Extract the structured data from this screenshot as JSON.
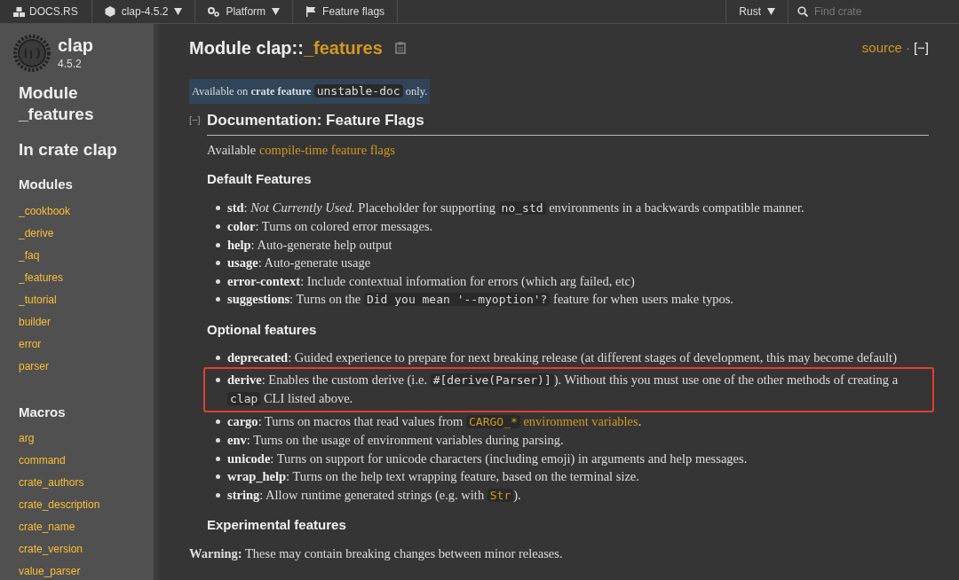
{
  "topbar": {
    "brand": "DOCS.RS",
    "menus": [
      {
        "kind": "crate",
        "label": "clap-4.5.2",
        "caret": true
      },
      {
        "kind": "platform",
        "label": "Platform",
        "caret": true
      },
      {
        "kind": "flags",
        "label": "Feature flags",
        "caret": false
      }
    ],
    "rust_menu": "Rust",
    "search": {
      "placeholder": "Find crate"
    }
  },
  "sidebar": {
    "crate": "clap",
    "version": "4.5.2",
    "module_title": "Module _features",
    "crate_link": "In crate clap",
    "sections": [
      {
        "title": "Modules",
        "items": [
          "_cookbook",
          "_derive",
          "_faq",
          "_features",
          "_tutorial",
          "builder",
          "error",
          "parser"
        ]
      },
      {
        "title": "Macros",
        "items": [
          "arg",
          "command",
          "crate_authors",
          "crate_description",
          "crate_name",
          "crate_version",
          "value_parser"
        ]
      }
    ]
  },
  "main": {
    "title_prefix": "Module clap::",
    "title_name": "_features",
    "source": "source",
    "separator": "·",
    "collapse": "[−]",
    "availability": [
      {
        "kind": "text",
        "text": "Available on "
      },
      {
        "kind": "bold",
        "text": "crate feature "
      },
      {
        "kind": "code",
        "text": "unstable-doc"
      },
      {
        "kind": "text",
        "text": " only."
      }
    ],
    "doc_toggle": "[−]",
    "doc_heading": "Documentation: Feature Flags",
    "intro": [
      {
        "kind": "text",
        "text": "Available "
      },
      {
        "kind": "link",
        "text": "compile-time feature flags"
      }
    ],
    "sections": [
      {
        "heading": "Default Features",
        "items": [
          {
            "name": "std",
            "highlighted": false,
            "parts": [
              {
                "kind": "text",
                "text": ": "
              },
              {
                "kind": "em",
                "text": "Not Currently Used."
              },
              {
                "kind": "text",
                "text": " Placeholder for supporting "
              },
              {
                "kind": "code",
                "text": "no_std"
              },
              {
                "kind": "text",
                "text": " environments in a backwards compatible manner."
              }
            ]
          },
          {
            "name": "color",
            "highlighted": false,
            "parts": [
              {
                "kind": "text",
                "text": ": Turns on colored error messages."
              }
            ]
          },
          {
            "name": "help",
            "highlighted": false,
            "parts": [
              {
                "kind": "text",
                "text": ": Auto-generate help output"
              }
            ]
          },
          {
            "name": "usage",
            "highlighted": false,
            "parts": [
              {
                "kind": "text",
                "text": ": Auto-generate usage"
              }
            ]
          },
          {
            "name": "error-context",
            "highlighted": false,
            "parts": [
              {
                "kind": "text",
                "text": ": Include contextual information for errors (which arg failed, etc)"
              }
            ]
          },
          {
            "name": "suggestions",
            "highlighted": false,
            "parts": [
              {
                "kind": "text",
                "text": ": Turns on the "
              },
              {
                "kind": "code",
                "text": "Did you mean '--myoption'?"
              },
              {
                "kind": "text",
                "text": " feature for when users make typos."
              }
            ]
          }
        ]
      },
      {
        "heading": "Optional features",
        "items": [
          {
            "name": "deprecated",
            "highlighted": false,
            "parts": [
              {
                "kind": "text",
                "text": ": Guided experience to prepare for next breaking release (at different stages of development, this may become default)"
              }
            ]
          },
          {
            "name": "derive",
            "highlighted": true,
            "parts": [
              {
                "kind": "text",
                "text": ": Enables the custom derive (i.e. "
              },
              {
                "kind": "code",
                "text": "#[derive(Parser)]"
              },
              {
                "kind": "text",
                "text": "). Without this you must use one of the other methods of creating a "
              },
              {
                "kind": "code",
                "text": "clap"
              },
              {
                "kind": "text",
                "text": " CLI listed above."
              }
            ]
          },
          {
            "name": "cargo",
            "highlighted": false,
            "parts": [
              {
                "kind": "text",
                "text": ": Turns on macros that read values from "
              },
              {
                "kind": "codelink",
                "text": "CARGO_*"
              },
              {
                "kind": "link",
                "text": " environment variables"
              },
              {
                "kind": "text",
                "text": "."
              }
            ]
          },
          {
            "name": "env",
            "highlighted": false,
            "parts": [
              {
                "kind": "text",
                "text": ": Turns on the usage of environment variables during parsing."
              }
            ]
          },
          {
            "name": "unicode",
            "highlighted": false,
            "parts": [
              {
                "kind": "text",
                "text": ": Turns on support for unicode characters (including emoji) in arguments and help messages."
              }
            ]
          },
          {
            "name": "wrap_help",
            "highlighted": false,
            "parts": [
              {
                "kind": "text",
                "text": ": Turns on the help text wrapping feature, based on the terminal size."
              }
            ]
          },
          {
            "name": "string",
            "highlighted": false,
            "parts": [
              {
                "kind": "text",
                "text": ": Allow runtime generated strings (e.g. with "
              },
              {
                "kind": "codelink",
                "text": "Str"
              },
              {
                "kind": "text",
                "text": ")."
              }
            ]
          }
        ]
      },
      {
        "heading": "Experimental features"
      }
    ],
    "warning": "**Warning:** These may contain breaking changes between minor releases."
  }
}
